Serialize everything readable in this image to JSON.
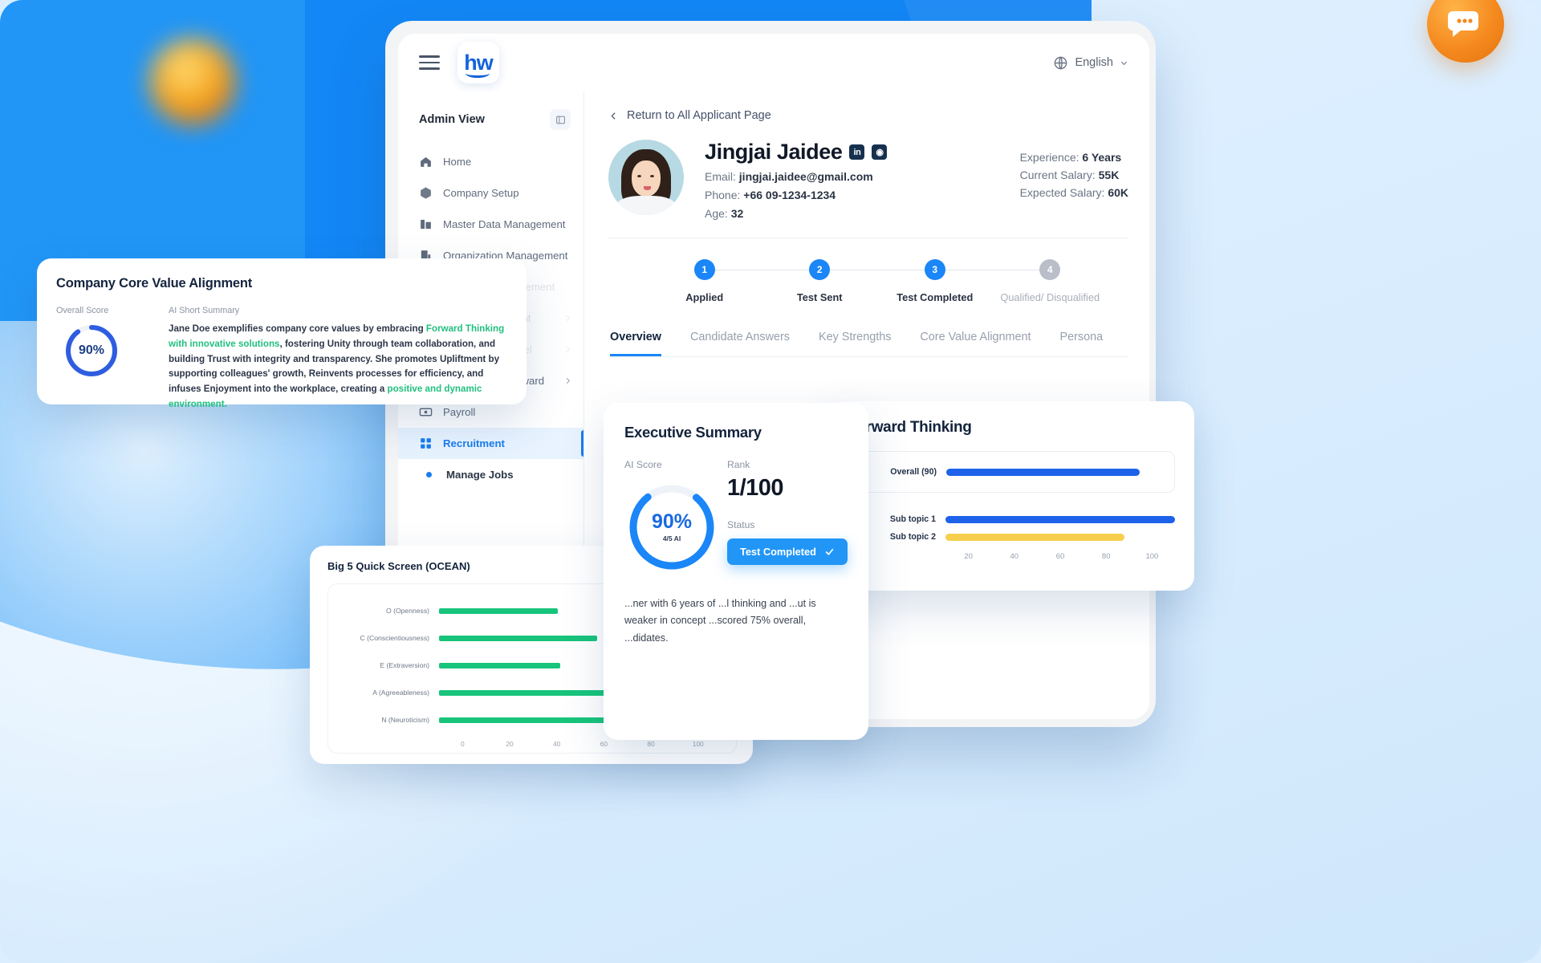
{
  "app": {
    "brand": "hw",
    "language": "English"
  },
  "sidebar": {
    "title": "Admin View",
    "items": [
      {
        "label": "Home",
        "icon": "home-icon",
        "state": "normal",
        "chevron": false
      },
      {
        "label": "Company Setup",
        "icon": "box-icon",
        "state": "normal",
        "chevron": false
      },
      {
        "label": "Master Data Management",
        "icon": "database-icon",
        "state": "normal",
        "chevron": false
      },
      {
        "label": "Organization Management",
        "icon": "org-chart-icon",
        "state": "normal",
        "chevron": false
      },
      {
        "label": "Employee Management",
        "icon": "people-icon",
        "state": "faded",
        "chevron": false
      },
      {
        "label": "Time Management",
        "icon": "clock-icon",
        "state": "faded",
        "chevron": true
      },
      {
        "label": "Performance Level",
        "icon": "chart-icon",
        "state": "faded",
        "chevron": true
      },
      {
        "label": "Point, Coin & Reward",
        "icon": "gift-icon",
        "state": "normal",
        "chevron": true
      },
      {
        "label": "Payroll",
        "icon": "money-icon",
        "state": "normal",
        "chevron": false
      },
      {
        "label": "Recruitment",
        "icon": "grid-icon",
        "state": "active",
        "chevron": false
      },
      {
        "label": "Manage Jobs",
        "icon": "dot-icon",
        "state": "sub",
        "chevron": false
      }
    ]
  },
  "content": {
    "return_link": "Return to All Applicant Page",
    "candidate": {
      "name": "Jingjai Jaidee",
      "badges": [
        "in",
        "⊕"
      ],
      "email_label": "Email:",
      "email": "jingjai.jaidee@gmail.com",
      "phone_label": "Phone:",
      "phone": "+66 09-1234-1234",
      "age_label": "Age:",
      "age": "32",
      "experience_label": "Experience:",
      "experience": "6 Years",
      "current_salary_label": "Current Salary:",
      "current_salary": "55K",
      "expected_salary_label": "Expected Salary:",
      "expected_salary": "60K"
    },
    "stepper": [
      {
        "num": "1",
        "label": "Applied",
        "done": true
      },
      {
        "num": "2",
        "label": "Test Sent",
        "done": true
      },
      {
        "num": "3",
        "label": "Test Completed",
        "done": true
      },
      {
        "num": "4",
        "label": "Qualified/ Disqualified",
        "done": false
      }
    ],
    "tabs": [
      {
        "label": "Overview",
        "active": true
      },
      {
        "label": "Candidate Answers",
        "active": false
      },
      {
        "label": "Key Strengths",
        "active": false
      },
      {
        "label": "Core Value Alignment",
        "active": false
      },
      {
        "label": "Persona",
        "active": false
      }
    ]
  },
  "core_value_card": {
    "title": "Company Core Value Alignment",
    "overall_score_label": "Overall Score",
    "overall_score": "90%",
    "overall_score_value": 90,
    "summary_label": "AI Short Summary",
    "summary_segments": [
      {
        "text": "Jane Doe exemplifies company core values by embracing ",
        "highlight": false
      },
      {
        "text": "Forward Thinking with innovative solutions",
        "highlight": true
      },
      {
        "text": ", fostering Unity through team collaboration, and building Trust with integrity and transparency. She promotes Upliftment by supporting colleagues' growth, Reinvents processes for efficiency, and infuses Enjoyment into the workplace, creating a ",
        "highlight": false
      },
      {
        "text": "positive and dynamic environment.",
        "highlight": true
      }
    ]
  },
  "executive_summary": {
    "title": "Executive Summary",
    "ai_score_label": "AI Score",
    "ai_score": "90%",
    "ai_score_value": 90,
    "ai_score_sub": "4/5 AI",
    "rank_label": "Rank",
    "rank": "1/100",
    "status_label": "Status",
    "status_value": "Test Completed",
    "paragraph": "...ner with 6 years of ...l thinking and ...ut is weaker in concept ...scored 75% overall, ...didates."
  },
  "forward_thinking": {
    "title": "Forward Thinking",
    "chart_data": {
      "type": "bar",
      "title": "Forward Thinking",
      "categories": [
        "Overall (90)",
        "Sub topic 1",
        "Sub topic 2"
      ],
      "values": [
        90,
        100,
        78
      ],
      "colors": [
        "#1d62e8",
        "#1d62e8",
        "#f7cf4e"
      ],
      "xlabel": "",
      "ylabel": "",
      "xlim": [
        0,
        100
      ],
      "ticks": [
        "20",
        "40",
        "60",
        "80",
        "100"
      ],
      "grid": false,
      "legend": "none"
    }
  },
  "big5": {
    "title": "Big 5 Quick Screen (OCEAN)",
    "chart_data": {
      "type": "bar",
      "title": "Big 5 Quick Screen (OCEAN)",
      "categories": [
        "O (Openness)",
        "C (Conscientiousness)",
        "E (Extraversion)",
        "A (Agreeableness)",
        "N (Neuroticism)"
      ],
      "values": [
        42,
        56,
        43,
        79,
        78
      ],
      "color": "#18c47b",
      "xlabel": "",
      "ylabel": "",
      "xlim": [
        0,
        100
      ],
      "ticks": [
        "0",
        "20",
        "40",
        "60",
        "80",
        "100"
      ],
      "grid": false,
      "legend": "none"
    }
  },
  "colors": {
    "primary": "#1a86f7",
    "accent_green": "#22c07f",
    "bar_blue": "#1d62e8",
    "bar_yellow": "#f7cf4e",
    "bar_green": "#18c47b",
    "background": "#dbeeff"
  }
}
